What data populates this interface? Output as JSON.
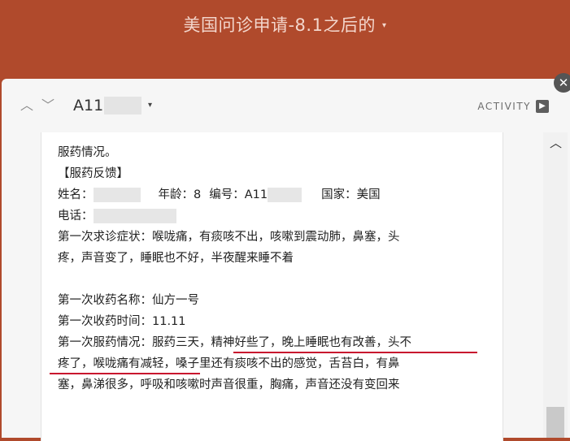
{
  "board": {
    "title": "美国问诊申请-8.1之后的",
    "title_caret": "▾"
  },
  "card": {
    "close_symbol": "✕",
    "nav_up_symbol": "︿",
    "nav_down_symbol": "﹀",
    "id_text": "A11",
    "id_caret": "▾",
    "activity_label": "ACTIVITY",
    "activity_icon_symbol": "▶"
  },
  "content": {
    "line1": "服药情况。",
    "line2": "【服药反馈】",
    "name_label": "姓名：",
    "age_text": "年龄：8",
    "number_label": "编号：A11",
    "country_text": "国家：美国",
    "phone_label": "电话：",
    "symptom_line1": "第一次求诊症状：喉咙痛，有痰咳不出，咳嗽到震动肺，鼻塞，头",
    "symptom_line2": "疼，声音变了，睡眠也不好，半夜醒来睡不着",
    "medicine_name": "第一次收药名称：仙方一号",
    "medicine_time": "第一次收药时间：11.11",
    "feedback_line1": "第一次服药情况：服药三天，精神好些了，晚上睡眠也有改善，头不",
    "feedback_line2": "疼了，喉咙痛有减轻，嗓子里还有痰咳不出的感觉，舌苔白，有鼻",
    "feedback_line3": "塞，鼻涕很多，呼吸和咳嗽时声音很重，胸痛，声音还没有变回来"
  },
  "scrollbar": {
    "up_symbol": "︿"
  },
  "colors": {
    "header_bg": "#b04a2c",
    "underline": "#c8102e",
    "modal_bg": "#f6f6f6"
  }
}
